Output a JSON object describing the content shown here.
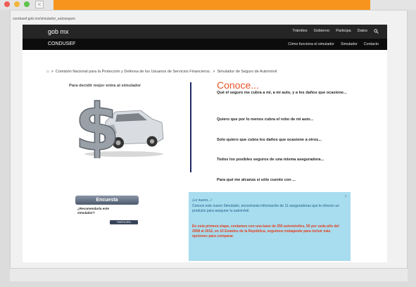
{
  "browser": {
    "back_glyph": "<"
  },
  "url": "condusef.gob.mx/simulador_autoseguro",
  "gob_bar": {
    "brand": "gob mx",
    "nav": [
      "Trámites",
      "Gobierno",
      "Participa",
      "Datos"
    ]
  },
  "condusef_bar": {
    "brand": "CONDUSEF",
    "nav": [
      "Cómo funciona el simulador",
      "Simulador",
      "Contacto"
    ]
  },
  "breadcrumb": {
    "item1": "Comisión Nacional para la Protección y Defensa de los Usuarios de Servicios Financieros.",
    "sep": ">",
    "item2": "Simulador de Seguro de Automóvil"
  },
  "left_title": "Para decidir mejor entra al simulador",
  "illustration": {
    "symbol": "$"
  },
  "conoce": {
    "title": "Conoce...",
    "questions": [
      "Qué el seguro me cubra a mí, a mi auto, y a los daños que ocasione...",
      "Quiero que por lo menos cubra el robo de mi auto...",
      "Solo quiero que cubra los daños que ocasione a otros...",
      "Todos los posibles seguros de una misma aseguradora...",
      "Para qué me alcanza si sólo cuento con ..."
    ]
  },
  "encuesta": {
    "label": "Encuesta",
    "question": "¿Recomendaría este simulador?",
    "button": "PARTICIPA"
  },
  "info_box": {
    "close": "×",
    "heading": "¡Lo nuevo...!",
    "body": "Conoce este nuevo Simulador, encontrarás información de 11 aseguradoras que te ofrecen un producto para asegurar tu automóvil.",
    "highlight": "En esta primera etapa, contamos con una base de 250 automóviles, 50 por cada año del 2008 al 2012, en 10 Estados de la República, seguimos trabajando para incluir más opciones para comparar."
  },
  "colors": {
    "orange": "#f7941d",
    "conoce": "#e8542a",
    "divider": "#1c2a63",
    "info_bg": "#a8dcef"
  }
}
